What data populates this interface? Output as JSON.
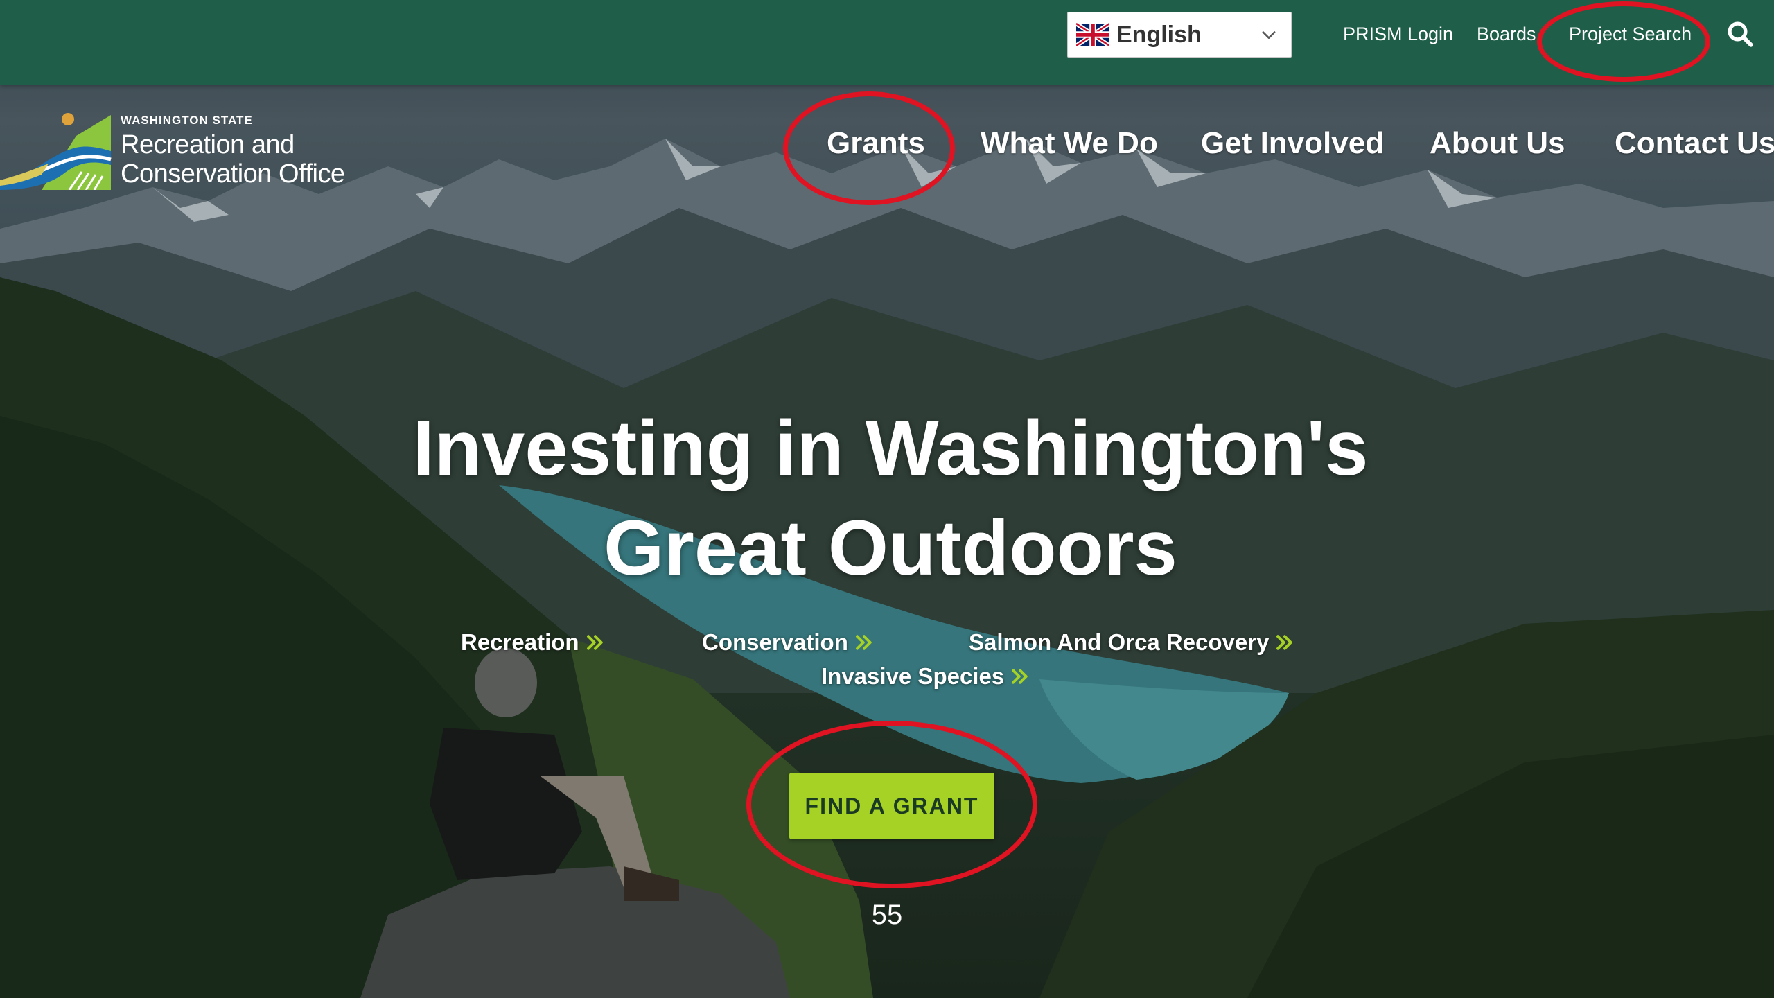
{
  "utility_bar": {
    "language": {
      "selected": "English",
      "flag_icon": "uk-flag-icon"
    },
    "links": [
      "PRISM Login",
      "Boards",
      "Project Search"
    ],
    "search_icon": "search-icon"
  },
  "logo": {
    "kicker": "WASHINGTON STATE",
    "line1": "Recreation and",
    "line2": "Conservation Office"
  },
  "main_nav": {
    "items": [
      "Grants",
      "What We Do",
      "Get Involved",
      "About Us",
      "Contact Us"
    ]
  },
  "hero": {
    "title_line1": "Investing in Washington's",
    "title_line2": "Great Outdoors",
    "categories": [
      "Recreation",
      "Conservation",
      "Salmon And Orca Recovery",
      "Invasive Species"
    ],
    "cta_label": "FIND A GRANT",
    "page_number": "55"
  },
  "colors": {
    "utility_bar": "#1f5e48",
    "cta": "#a6d225",
    "chevron": "#a6d225",
    "annotation": "#e01323"
  }
}
